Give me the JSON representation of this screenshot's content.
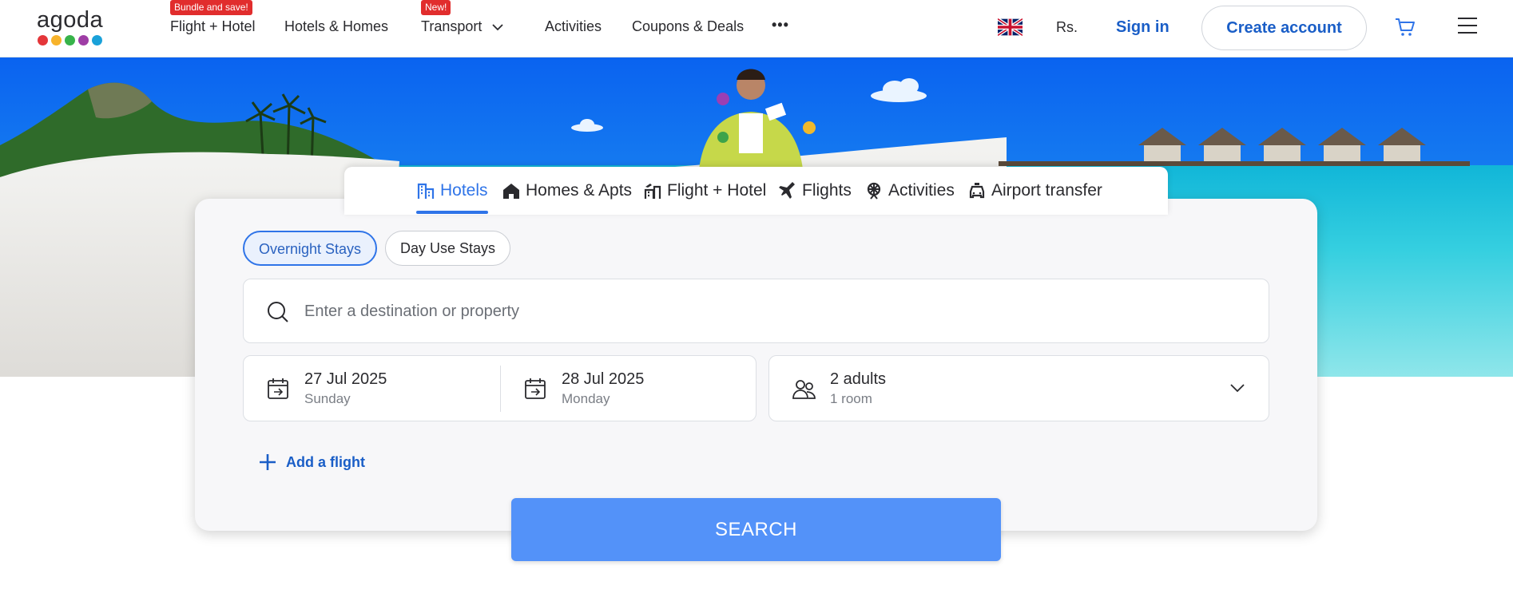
{
  "header": {
    "logo_text": "agoda",
    "logo_colors": [
      "#e4363a",
      "#f7b32b",
      "#37b34a",
      "#9e3da5",
      "#1aa1d9"
    ],
    "nav": [
      {
        "label": "Flight + Hotel",
        "badge": "Bundle and save!"
      },
      {
        "label": "Hotels & Homes"
      },
      {
        "label": "Transport",
        "badge": "New!"
      },
      {
        "label": "Activities"
      },
      {
        "label": "Coupons & Deals"
      },
      {
        "label": "•••"
      }
    ],
    "currency": "Rs.",
    "sign_in": "Sign in",
    "create_account": "Create account"
  },
  "product_tabs": [
    {
      "label": "Hotels",
      "icon": "hotel-icon",
      "active": true
    },
    {
      "label": "Homes & Apts",
      "icon": "home-icon"
    },
    {
      "label": "Flight + Hotel",
      "icon": "flight-hotel-icon"
    },
    {
      "label": "Flights",
      "icon": "plane-icon"
    },
    {
      "label": "Activities",
      "icon": "activities-icon"
    },
    {
      "label": "Airport transfer",
      "icon": "car-icon"
    }
  ],
  "search": {
    "stay_types": [
      "Overnight Stays",
      "Day Use Stays"
    ],
    "destination_placeholder": "Enter a destination or property",
    "checkin": {
      "date": "27 Jul 2025",
      "day": "Sunday"
    },
    "checkout": {
      "date": "28 Jul 2025",
      "day": "Monday"
    },
    "guests": {
      "adults": "2 adults",
      "rooms": "1 room"
    },
    "add_flight": "Add a flight",
    "search_button": "SEARCH"
  },
  "colors": {
    "brand_blue": "#2f74e8",
    "link_blue": "#1a5ec7",
    "search_button": "#5392f9",
    "badge_red": "#e12d2d"
  }
}
